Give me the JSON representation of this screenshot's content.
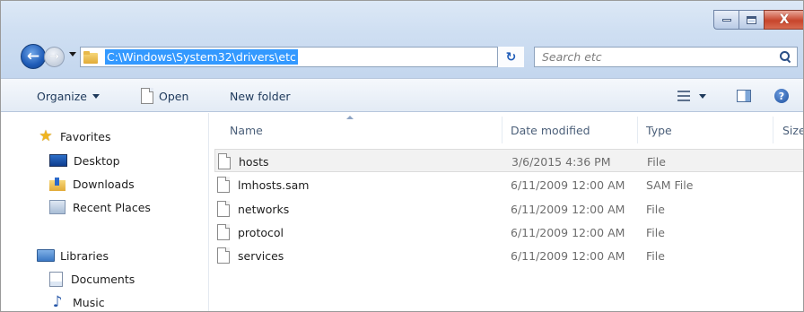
{
  "window": {
    "minimize_icon": "minimize-icon",
    "maximize_icon": "maximize-icon",
    "close_label": "X"
  },
  "navigation": {
    "back_glyph": "←",
    "forward_glyph": "→",
    "address_path": "C:\\Windows\\System32\\drivers\\etc",
    "refresh_glyph": "↻",
    "search_placeholder": "Search etc"
  },
  "toolbar": {
    "organize_label": "Organize",
    "open_label": "Open",
    "new_folder_label": "New folder",
    "help_glyph": "?"
  },
  "sidebar": {
    "favorites_label": "Favorites",
    "favorites": [
      {
        "label": "Desktop"
      },
      {
        "label": "Downloads"
      },
      {
        "label": "Recent Places"
      }
    ],
    "libraries_label": "Libraries",
    "libraries": [
      {
        "label": "Documents"
      },
      {
        "label": "Music"
      }
    ]
  },
  "file_list": {
    "columns": {
      "name": "Name",
      "date": "Date modified",
      "type": "Type",
      "size": "Size"
    },
    "rows": [
      {
        "name": "hosts",
        "date": "3/6/2015 4:36 PM",
        "type": "File"
      },
      {
        "name": "lmhosts.sam",
        "date": "6/11/2009 12:00 AM",
        "type": "SAM File"
      },
      {
        "name": "networks",
        "date": "6/11/2009 12:00 AM",
        "type": "File"
      },
      {
        "name": "protocol",
        "date": "6/11/2009 12:00 AM",
        "type": "File"
      },
      {
        "name": "services",
        "date": "6/11/2009 12:00 AM",
        "type": "File"
      }
    ]
  },
  "colors": {
    "selection": "#3399ff",
    "chrome": "#cfdff2",
    "close_button": "#c7452c"
  }
}
